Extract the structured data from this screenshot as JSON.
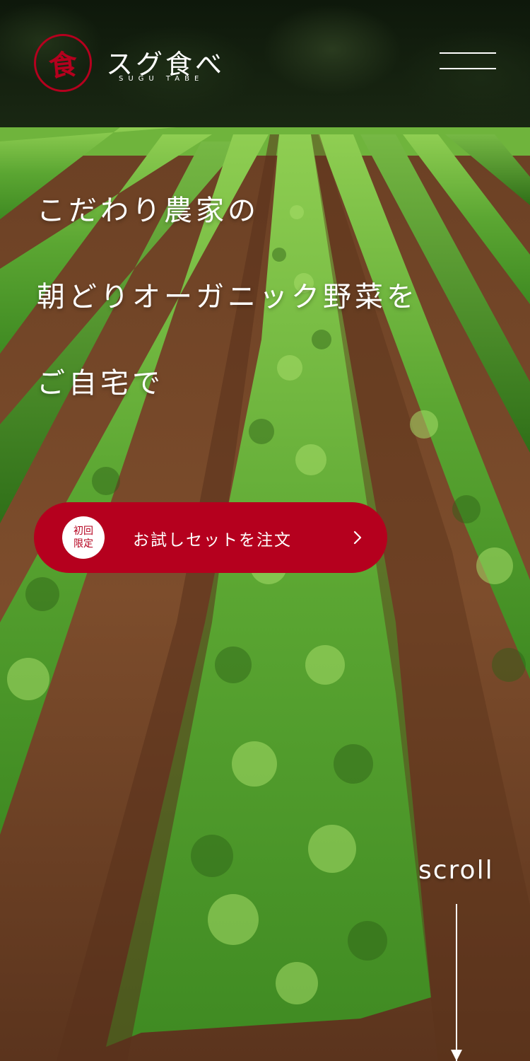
{
  "header": {
    "logo_mark": "食",
    "brand_name": "スグ食べ",
    "brand_sub": "SUGU TABE"
  },
  "hero": {
    "lines": [
      "こだわり農家の",
      "朝どりオーガニック野菜を",
      "ご自宅で"
    ]
  },
  "cta": {
    "badge_top": "初回",
    "badge_bottom": "限定",
    "label": "お試しセットを注文"
  },
  "scroll": {
    "label": "scroll"
  },
  "colors": {
    "brand": "#b5001e",
    "text": "#ffffff"
  },
  "icons": {
    "menu": "hamburger-icon",
    "cta_arrow": "chevron-right-icon",
    "scroll": "arrow-down-icon"
  }
}
